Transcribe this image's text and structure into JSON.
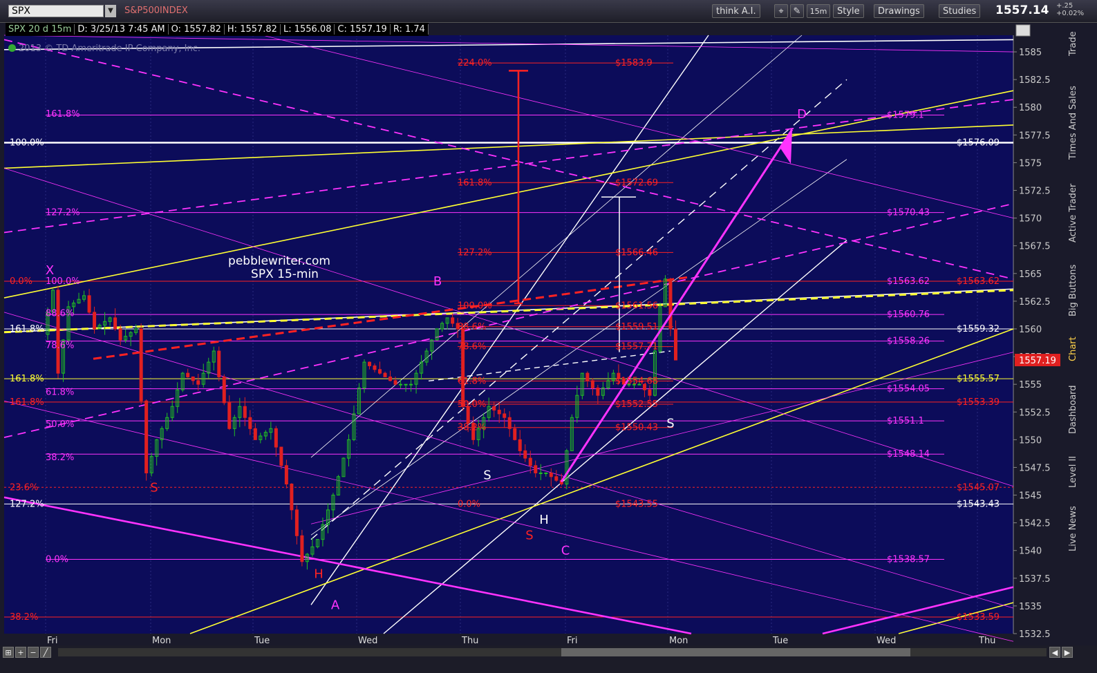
{
  "toolbar": {
    "symbol": "SPX",
    "index_name": "S&P500INDEX",
    "buttons": [
      "think A.I.",
      "15m",
      "Style",
      "Drawings",
      "Studies"
    ],
    "last": "1557.14",
    "change_abs": "+.25",
    "change_pct": "+0.02%"
  },
  "infobar": {
    "symbol": "SPX 20 d 15m",
    "date": "D: 3/25/13 7:45 AM",
    "open": "O: 1557.82",
    "high": "H: 1557.82",
    "low": "L: 1556.08",
    "close": "C: 1557.19",
    "range": "R: 1.74"
  },
  "copyright": "2013 © TD Ameritrade IP Company, Inc.",
  "side_tabs": [
    "Trade",
    "Times And Sales",
    "Active Trader",
    "Big Buttons",
    "Chart",
    "Dashboard",
    "Level II",
    "Live News"
  ],
  "colors": {
    "background": "#0c0c5a",
    "up": "#22c022",
    "down": "#e02020",
    "magenta": "#ff33ff",
    "yellow": "#ffff33",
    "white": "#ffffff",
    "red": "#ff2222"
  },
  "chart_data": {
    "type": "candlestick",
    "instrument": "SPX",
    "interval": "15-min",
    "ylim": [
      1532.5,
      1586.5
    ],
    "yticks": [
      1532.5,
      1535,
      1537.5,
      1540,
      1542.5,
      1545,
      1547.5,
      1550,
      1552.5,
      1555,
      1557.5,
      1560,
      1562.5,
      1565,
      1567.5,
      1570,
      1572.5,
      1575,
      1577.5,
      1580,
      1582.5,
      1585
    ],
    "x_day_labels": [
      "Fri",
      "Mon",
      "Tue",
      "Wed",
      "Thu",
      "Fri",
      "Mon",
      "Tue",
      "Wed",
      "Thu"
    ],
    "last_price_label": "1557.19",
    "watermark": [
      "pebblewriter.com",
      "SPX 15-min"
    ],
    "price_path": [
      [
        0,
        1559.5
      ],
      [
        2,
        1563.5
      ],
      [
        3,
        1556
      ],
      [
        5,
        1562
      ],
      [
        8,
        1563
      ],
      [
        10,
        1560
      ],
      [
        13,
        1561
      ],
      [
        15,
        1559
      ],
      [
        18,
        1560
      ],
      [
        20,
        1547
      ],
      [
        22,
        1550
      ],
      [
        25,
        1553
      ],
      [
        27,
        1556
      ],
      [
        30,
        1555
      ],
      [
        33,
        1558
      ],
      [
        36,
        1551
      ],
      [
        38,
        1553
      ],
      [
        41,
        1550
      ],
      [
        44,
        1551
      ],
      [
        47,
        1546
      ],
      [
        50,
        1539
      ],
      [
        53,
        1541
      ],
      [
        56,
        1545
      ],
      [
        59,
        1550
      ],
      [
        62,
        1557
      ],
      [
        65,
        1556
      ],
      [
        68,
        1555
      ],
      [
        71,
        1555
      ],
      [
        74,
        1558
      ],
      [
        76,
        1560
      ],
      [
        78,
        1561
      ],
      [
        80,
        1560
      ],
      [
        81,
        1553
      ],
      [
        83,
        1550
      ],
      [
        86,
        1553
      ],
      [
        89,
        1552
      ],
      [
        92,
        1549
      ],
      [
        95,
        1547
      ],
      [
        97,
        1547
      ],
      [
        100,
        1546
      ],
      [
        102,
        1552
      ],
      [
        104,
        1556
      ],
      [
        107,
        1554
      ],
      [
        110,
        1556
      ],
      [
        112,
        1555
      ],
      [
        115,
        1555
      ],
      [
        117,
        1554
      ],
      [
        118,
        1558
      ],
      [
        119,
        1562
      ],
      [
        120,
        1564.5
      ],
      [
        121,
        1560
      ],
      [
        122,
        1557.19
      ]
    ],
    "annotations": [
      {
        "text": "X",
        "price": 1565.3,
        "color": "#ff33ff"
      },
      {
        "text": "A",
        "price": 1535.1,
        "color": "#ff33ff"
      },
      {
        "text": "B",
        "price": 1564.3,
        "color": "#ff33ff"
      },
      {
        "text": "C",
        "price": 1540,
        "color": "#ff33ff"
      },
      {
        "text": "D",
        "price": 1579.4,
        "color": "#ff33ff"
      },
      {
        "text": "S",
        "price": 1545.7,
        "color": "#ff2222"
      },
      {
        "text": "H",
        "price": 1537.9,
        "color": "#ff2222"
      },
      {
        "text": "S",
        "price": 1541.4,
        "color": "#ff2222"
      },
      {
        "text": "S",
        "price": 1546.8,
        "color": "#ffffff"
      },
      {
        "text": "H",
        "price": 1542.8,
        "color": "#ffffff"
      },
      {
        "text": "S",
        "price": 1551.5,
        "color": "#ffffff"
      }
    ],
    "fib_labels_left": [
      {
        "text": "161.8%",
        "price": 1579.4,
        "color": "#ff33ff"
      },
      {
        "text": "100.0%",
        "price": 1576.8,
        "color": "#ffffff"
      },
      {
        "text": "127.2%",
        "price": 1570.5,
        "color": "#ff33ff"
      },
      {
        "text": "0.0%",
        "price": 1564.3,
        "color": "#ff2222"
      },
      {
        "text": "100.0%",
        "price": 1564.3,
        "color": "#ff33ff"
      },
      {
        "text": "88.6%",
        "price": 1561.4,
        "color": "#ff33ff"
      },
      {
        "text": "161.8%",
        "price": 1560,
        "color": "#ffffff"
      },
      {
        "text": "78.6%",
        "price": 1558.5,
        "color": "#ff33ff"
      },
      {
        "text": "161.8%",
        "price": 1555.5,
        "color": "#ffff33"
      },
      {
        "text": "61.8%",
        "price": 1554.3,
        "color": "#ff33ff"
      },
      {
        "text": "161.8%",
        "price": 1553.4,
        "color": "#ff2222"
      },
      {
        "text": "50.0%",
        "price": 1551.4,
        "color": "#ff33ff"
      },
      {
        "text": "38.2%",
        "price": 1548.4,
        "color": "#ff33ff"
      },
      {
        "text": "23.6%",
        "price": 1545.7,
        "color": "#ff2222"
      },
      {
        "text": "127.2%",
        "price": 1544.2,
        "color": "#ffffff"
      },
      {
        "text": "0.0%",
        "price": 1539.2,
        "color": "#ff33ff"
      },
      {
        "text": "38.2%",
        "price": 1534,
        "color": "#ff2222"
      }
    ],
    "fib_labels_mid": [
      {
        "text": "224.0%",
        "price": 1584,
        "color": "#ff2222"
      },
      {
        "text": "161.8%",
        "price": 1573.2,
        "color": "#ff2222"
      },
      {
        "text": "127.2%",
        "price": 1566.9,
        "color": "#ff2222"
      },
      {
        "text": "100.0%",
        "price": 1562.1,
        "color": "#ff2222"
      },
      {
        "text": "88.6%",
        "price": 1560.2,
        "color": "#ff2222"
      },
      {
        "text": "78.6%",
        "price": 1558.4,
        "color": "#ff2222"
      },
      {
        "text": "61.8%",
        "price": 1555.3,
        "color": "#ff2222"
      },
      {
        "text": "50.0%",
        "price": 1553.2,
        "color": "#ff2222"
      },
      {
        "text": "38.2%",
        "price": 1551.1,
        "color": "#ff2222"
      },
      {
        "text": "0.0%",
        "price": 1544.2,
        "color": "#ff2222"
      }
    ],
    "price_labels_mid": [
      {
        "text": "$1583.9",
        "price": 1584,
        "color": "#ff2222"
      },
      {
        "text": "$1572.69",
        "price": 1573.2,
        "color": "#ff2222"
      },
      {
        "text": "$1566.46",
        "price": 1566.9,
        "color": "#ff2222"
      },
      {
        "text": "$1561.56",
        "price": 1562.1,
        "color": "#ff2222"
      },
      {
        "text": "$1559.51",
        "price": 1560.2,
        "color": "#ff2222"
      },
      {
        "text": "$1557.71",
        "price": 1558.4,
        "color": "#ff2222"
      },
      {
        "text": "$1554.68",
        "price": 1555.3,
        "color": "#ff2222"
      },
      {
        "text": "$1552.55",
        "price": 1553.2,
        "color": "#ff2222"
      },
      {
        "text": "$1550.43",
        "price": 1551.1,
        "color": "#ff2222"
      },
      {
        "text": "$1543.55",
        "price": 1544.2,
        "color": "#ff2222"
      }
    ],
    "price_labels_right": [
      {
        "text": "$1579.1",
        "price": 1579.3,
        "color": "#ff33ff"
      },
      {
        "text": "$1570.43",
        "price": 1570.5,
        "color": "#ff33ff"
      },
      {
        "text": "$1563.62",
        "price": 1564.3,
        "color": "#ff33ff"
      },
      {
        "text": "$1560.76",
        "price": 1561.3,
        "color": "#ff33ff"
      },
      {
        "text": "$1558.26",
        "price": 1558.9,
        "color": "#ff33ff"
      },
      {
        "text": "$1554.05",
        "price": 1554.6,
        "color": "#ff33ff"
      },
      {
        "text": "$1551.1",
        "price": 1551.7,
        "color": "#ff33ff"
      },
      {
        "text": "$1548.14",
        "price": 1548.7,
        "color": "#ff33ff"
      },
      {
        "text": "$1538.57",
        "price": 1539.2,
        "color": "#ff33ff"
      }
    ],
    "price_labels_far_right": [
      {
        "text": "$1563.62",
        "price": 1564.3,
        "color": "#ff2222"
      },
      {
        "text": "$1553.39",
        "price": 1553.4,
        "color": "#ff2222"
      },
      {
        "text": "$1545.07",
        "price": 1545.7,
        "color": "#ff2222"
      },
      {
        "text": "$1533.59",
        "price": 1534,
        "color": "#ff2222"
      }
    ],
    "price_labels_white": [
      {
        "text": "$1576.09",
        "price": 1576.8,
        "color": "#ffffff"
      },
      {
        "text": "$1559.32",
        "price": 1560,
        "color": "#ffffff"
      },
      {
        "text": "$1543.43",
        "price": 1544.2,
        "color": "#ffffff"
      }
    ],
    "price_labels_yellow": [
      {
        "text": "$1555.57",
        "price": 1555.5,
        "color": "#ffff33"
      }
    ]
  }
}
